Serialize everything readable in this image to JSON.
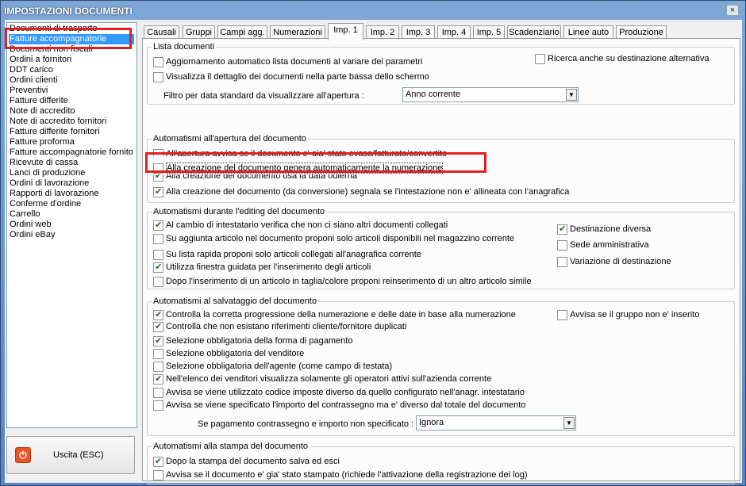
{
  "window": {
    "title": "IMPOSTAZIONI DOCUMENTI",
    "close_label": "×"
  },
  "doc_list": [
    "Documenti di trasporto",
    "Fatture accompagnatorie",
    "Documenti non fiscali",
    "Ordini a fornitori",
    "DDT carico",
    "Ordini clienti",
    "Preventivi",
    "Fatture differite",
    "Note di accredito",
    "Note di accredito fornitori",
    "Fatture differite fornitori",
    "Fatture proforma",
    "Fatture accompagnatorie fornito",
    "Ricevute di cassa",
    "Lanci di produzione",
    "Ordini di lavorazione",
    "Rapporti di lavorazione",
    "Conferme d'ordine",
    "Carrello",
    "Ordini web",
    "Ordini eBay"
  ],
  "selected_doc_index": 1,
  "exit_button": {
    "label": "Uscita (ESC)",
    "icon": "power-icon"
  },
  "tabs": [
    "Causali",
    "Gruppi",
    "Campi agg.",
    "Numerazioni",
    "Imp. 1",
    "Imp. 2",
    "Imp. 3",
    "Imp. 4",
    "Imp. 5",
    "Scadenziario",
    "Linee auto",
    "Produzione"
  ],
  "active_tab_index": 4,
  "lista": {
    "title": "Lista documenti",
    "opt1": {
      "label": "Aggiornamento automatico lista documenti al variare dei parametri",
      "checked": false
    },
    "opt2": {
      "label": "Visualizza il dettaglio dei documenti nella parte bassa dello schermo",
      "checked": false
    },
    "opt3": {
      "label": "Ricerca anche su destinazione alternativa",
      "checked": false
    },
    "filter_label": "Filtro per data standard da visualizzare all'apertura :",
    "filter_value": "Anno corrente"
  },
  "apertura": {
    "title": "Automatismi all'apertura del documento",
    "opt1": {
      "label": "All'apertura avvisa se il documento e' gia' stato evaso/fatturato/convertito",
      "checked": false
    },
    "opt2": {
      "label": "Alla creazione del documento genera automaticamente la numerazione",
      "checked": false
    },
    "opt3": {
      "label": "Alla creazione del documento usa la data odierna",
      "checked": true
    },
    "opt4": {
      "label": "Alla creazione del documento (da conversione) segnala se l'intestazione non e' allineata con l'anagrafica",
      "checked": true
    }
  },
  "editing": {
    "title": "Automatismi durante l'editing del documento",
    "opt1": {
      "label": "Al cambio di intestatario verifica che non ci siano altri documenti collegati",
      "checked": true
    },
    "opt2": {
      "label": "Su aggiunta articolo nel documento proponi solo articoli disponibili nel magazzino corrente",
      "checked": false
    },
    "opt3": {
      "label": "Su lista rapida proponi solo articoli collegati all'anagrafica corrente",
      "checked": false
    },
    "opt4": {
      "label": "Utilizza finestra guidata per l'inserimento degli articoli",
      "checked": true
    },
    "opt5": {
      "label": "Dopo l'inserimento di un articolo in taglia/colore proponi reinserimento di un altro articolo simile",
      "checked": false
    },
    "r1": {
      "label": "Destinazione diversa",
      "checked": true
    },
    "r2": {
      "label": "Sede amministrativa",
      "checked": false
    },
    "r3": {
      "label": "Variazione di destinazione",
      "checked": false
    }
  },
  "salvataggio": {
    "title": "Automatismi al salvataggio del documento",
    "opt1": {
      "label": "Controlla la corretta progressione della numerazione e delle date in base alla numerazione",
      "checked": true
    },
    "opt2": {
      "label": "Controlla che non esistano riferimenti cliente/fornitore duplicati",
      "checked": true
    },
    "opt3": {
      "label": "Selezione obbligatoria della forma di pagamento",
      "checked": true
    },
    "opt4": {
      "label": "Selezione obbligatoria del venditore",
      "checked": false
    },
    "opt5": {
      "label": "Selezione obbligatoria dell'agente (come campo di testata)",
      "checked": false
    },
    "opt6": {
      "label": "Nell'elenco dei venditori visualizza solamente gli operatori attivi sull'azienda corrente",
      "checked": true
    },
    "opt7": {
      "label": "Avvisa se viene utilizzato codice imposte diverso da quello configurato nell'anagr. intestatario",
      "checked": false
    },
    "opt8": {
      "label": "Avvisa se viene specificato l'importo del contrassegno ma e' diverso dal totale del documento",
      "checked": false
    },
    "r1": {
      "label": "Avvisa se il gruppo non e' inserito",
      "checked": false
    },
    "payment_label": "Se pagamento contrassegno e importo non specificato :",
    "payment_value": "Ignora"
  },
  "stampa": {
    "title": "Automatismi alla stampa del documento",
    "opt1": {
      "label": "Dopo la stampa del documento salva ed esci",
      "checked": true
    },
    "opt2": {
      "label": "Avvisa se il documento e' gia' stato stampato (richiede l'attivazione della registrazione dei log)",
      "checked": false
    }
  },
  "colors": {
    "highlight": "#e02020",
    "selection": "#3399ff",
    "title_bar": "#5b85c0"
  }
}
